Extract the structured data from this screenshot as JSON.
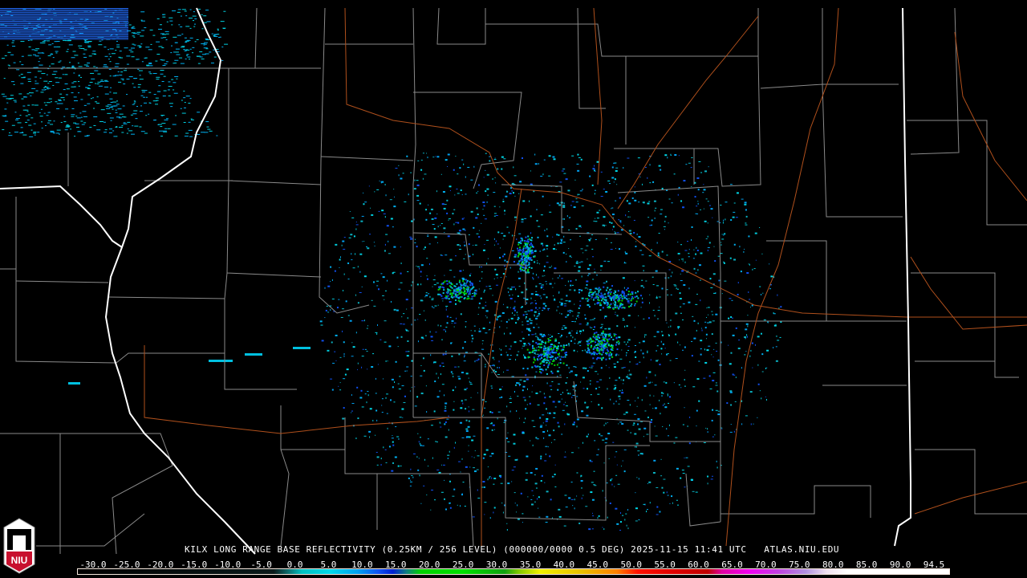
{
  "title": "KILX LONG RANGE BASE REFLECTIVITY (0.25KM / 256 LEVEL) (000000/0000 0.5 DEG) 2025-11-15 11:41 UTC   ATLAS.NIU.EDU",
  "logo_text": "NIU",
  "colorbar": {
    "labels": [
      "-30.0",
      "-25.0",
      "-20.0",
      "-15.0",
      "-10.0",
      "-5.0",
      "0.0",
      "5.0",
      "10.0",
      "15.0",
      "20.0",
      "25.0",
      "30.0",
      "35.0",
      "40.0",
      "45.0",
      "50.0",
      "55.0",
      "60.0",
      "65.0",
      "70.0",
      "75.0",
      "80.0",
      "85.0",
      "90.0",
      "94.5"
    ],
    "range": [
      -30,
      94.5
    ],
    "stops": [
      {
        "v": -30,
        "c": "#000000"
      },
      {
        "v": -2,
        "c": "#0a1a1a"
      },
      {
        "v": 0,
        "c": "#0e6b6b"
      },
      {
        "v": 2,
        "c": "#00c0c0"
      },
      {
        "v": 6,
        "c": "#00d8e8"
      },
      {
        "v": 10,
        "c": "#00a0f0"
      },
      {
        "v": 13,
        "c": "#1050f0"
      },
      {
        "v": 15,
        "c": "#0020d0"
      },
      {
        "v": 17,
        "c": "#108080"
      },
      {
        "v": 19,
        "c": "#00d000"
      },
      {
        "v": 25,
        "c": "#00e000"
      },
      {
        "v": 31,
        "c": "#10a010"
      },
      {
        "v": 33,
        "c": "#80c800"
      },
      {
        "v": 36,
        "c": "#f0f000"
      },
      {
        "v": 42,
        "c": "#e8c000"
      },
      {
        "v": 47,
        "c": "#ff8000"
      },
      {
        "v": 50,
        "c": "#ff1000"
      },
      {
        "v": 55,
        "c": "#e00000"
      },
      {
        "v": 60,
        "c": "#c00000"
      },
      {
        "v": 62,
        "c": "#e000a0"
      },
      {
        "v": 66,
        "c": "#f000f0"
      },
      {
        "v": 70,
        "c": "#c040e0"
      },
      {
        "v": 74,
        "c": "#b090e0"
      },
      {
        "v": 77,
        "c": "#f0e0f0"
      },
      {
        "v": 80,
        "c": "#ffffff"
      },
      {
        "v": 94.5,
        "c": "#ffffff"
      }
    ]
  },
  "colors": {
    "state_border": "#ffffff",
    "county_border": "#8a8a8a",
    "rivers": "#b0501c",
    "background": "#000000"
  }
}
